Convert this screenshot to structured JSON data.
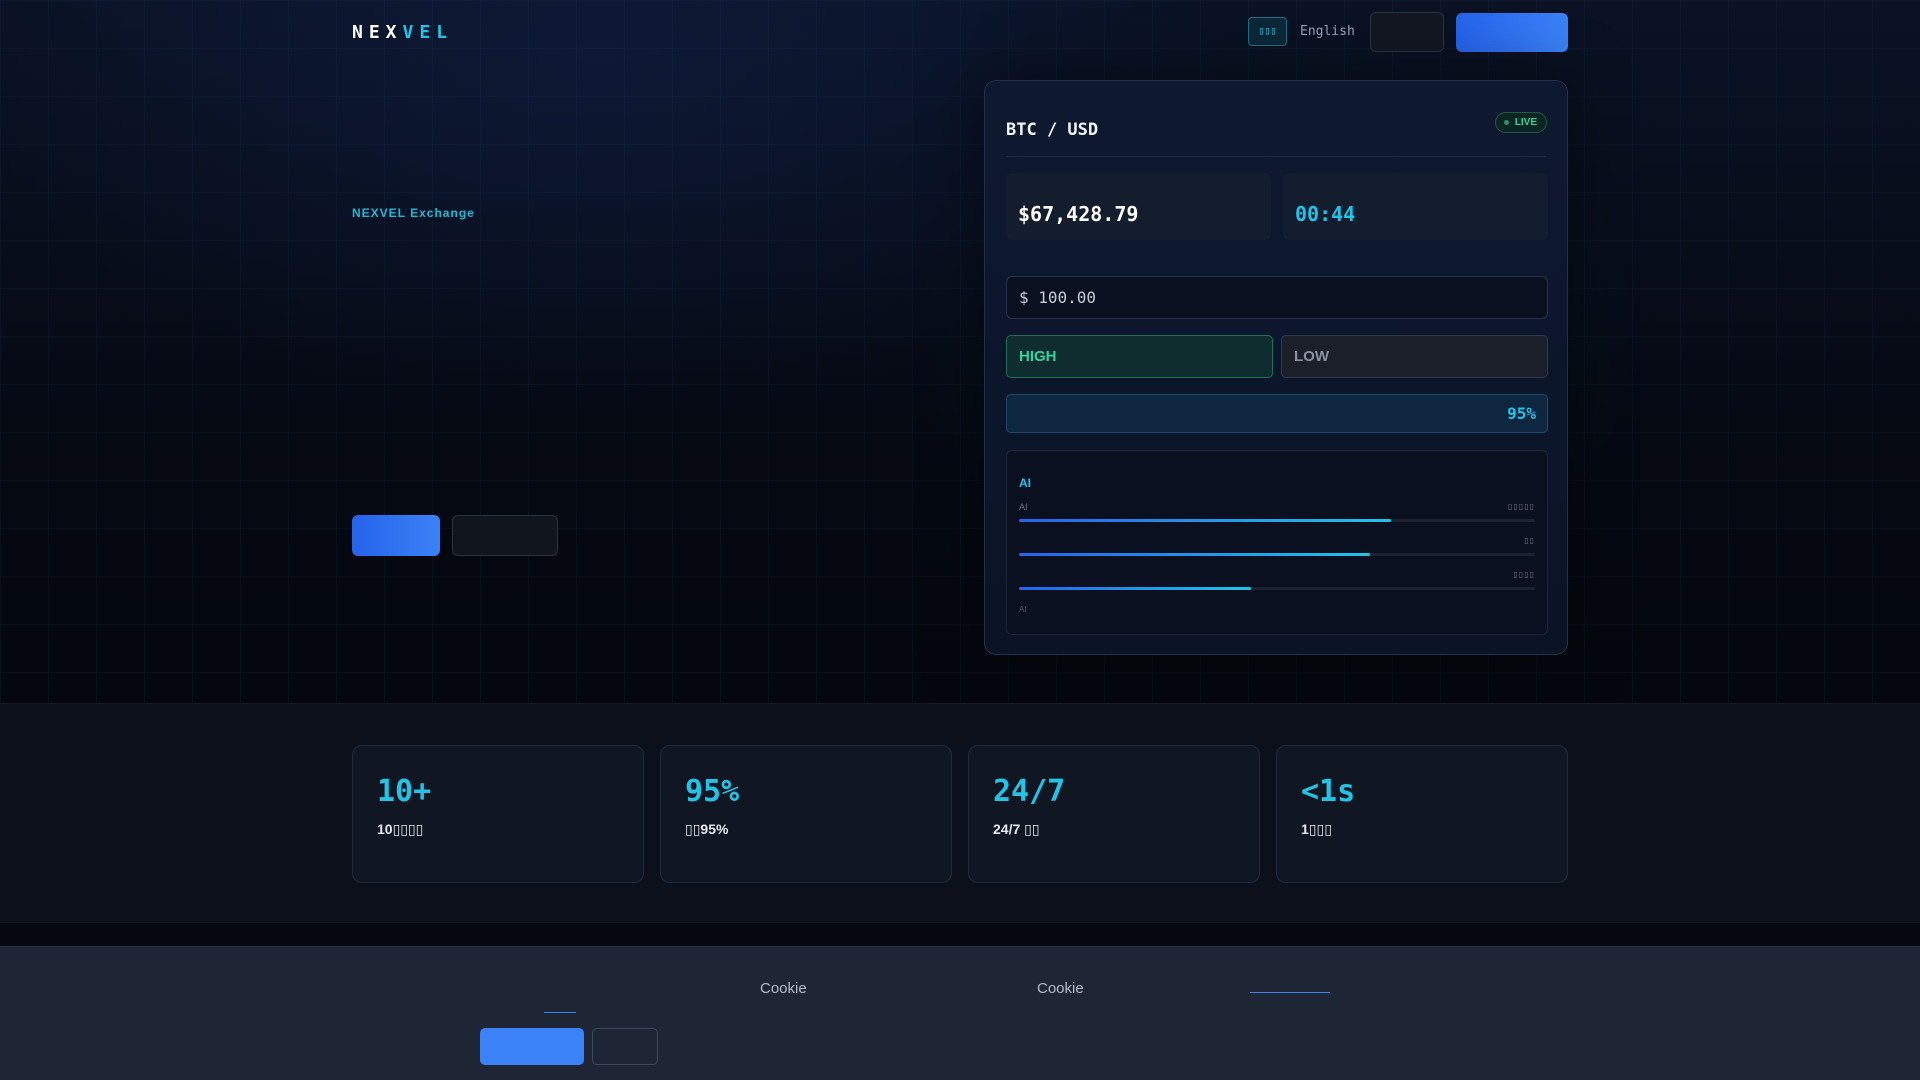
{
  "header": {
    "logo_main": "NEX",
    "logo_accent": "VEL",
    "lang_short": "▯▯▯",
    "lang_label": "English"
  },
  "hero": {
    "eyebrow": "NEXVEL Exchange"
  },
  "trade": {
    "pair": "BTC / USD",
    "status": "LIVE",
    "price": "$67,428.79",
    "timer": "00:44",
    "amount": "$ 100.00",
    "high_label": "HIGH",
    "low_label": "LOW",
    "payout": "95%",
    "ai": {
      "title": "AI",
      "rows": [
        {
          "label": "AI",
          "right": "▯▯▯▯▯",
          "fill": 0.72
        },
        {
          "label": "",
          "right": "▯▯",
          "fill": 0.68
        },
        {
          "label": "",
          "right": "▯▯▯▯",
          "fill": 0.45
        }
      ],
      "footer": "AI"
    }
  },
  "stats": [
    {
      "value": "10+",
      "caption": "10▯▯▯▯"
    },
    {
      "value": "95%",
      "caption": "▯▯95%"
    },
    {
      "value": "24/7",
      "caption": "24/7 ▯▯"
    },
    {
      "value": "<1s",
      "caption": "1▯▯▯"
    }
  ],
  "cookie": {
    "text_1": "Cookie",
    "text_2": "Cookie"
  },
  "colors": {
    "accent_cyan": "#22c3e6",
    "primary_blue": "#3b82f6",
    "success_green": "#34d399",
    "background": "#05080f"
  }
}
